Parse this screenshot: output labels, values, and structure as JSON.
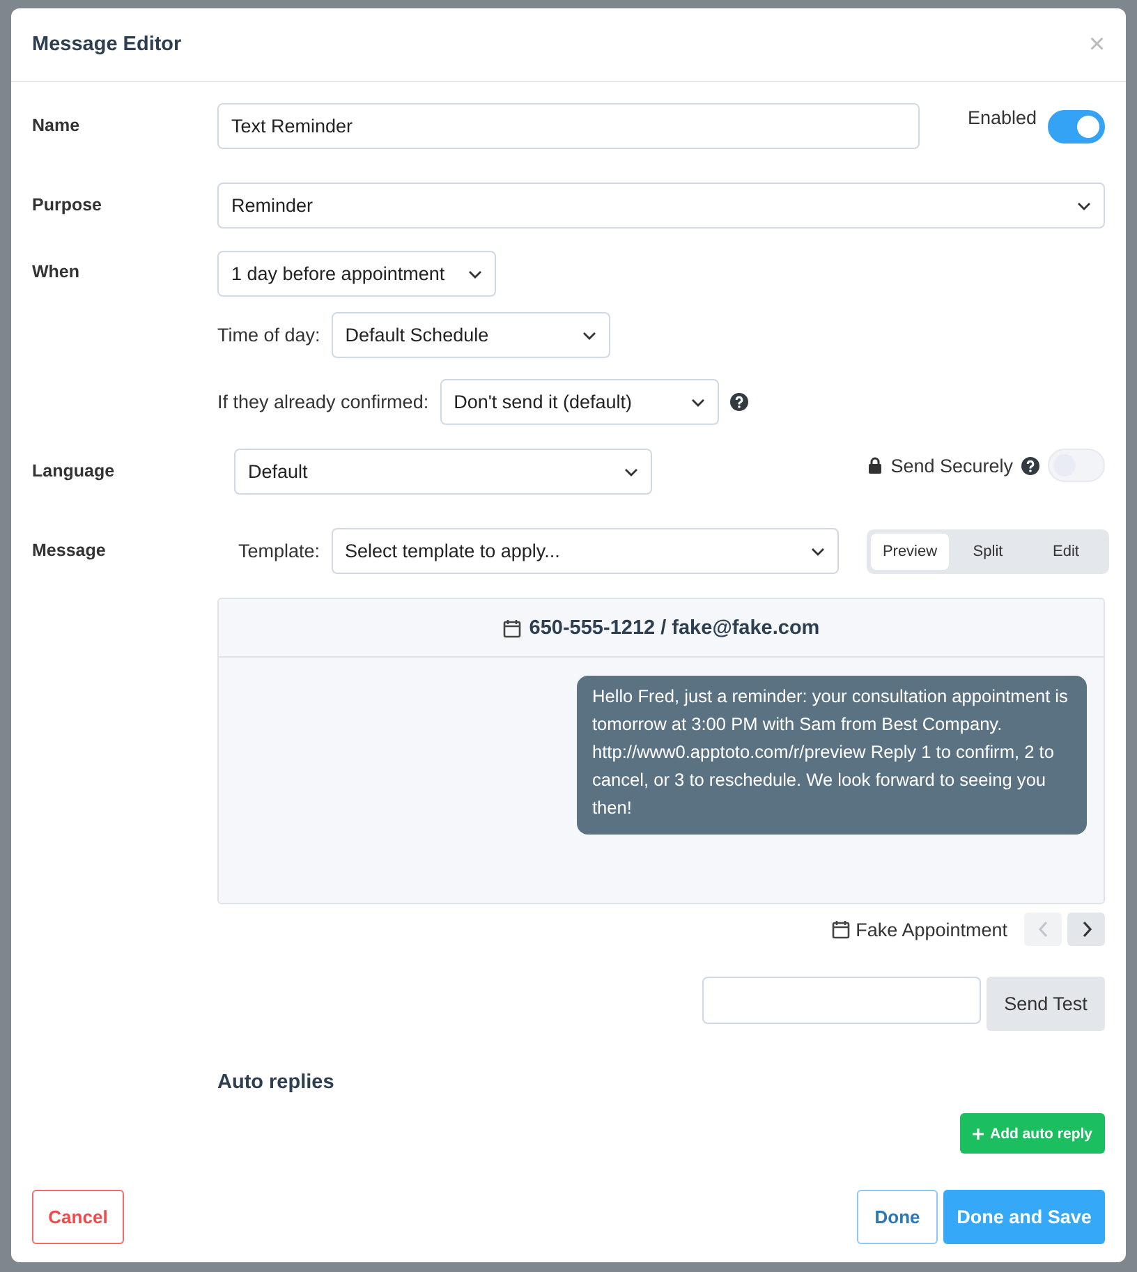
{
  "dialog": {
    "title": "Message Editor",
    "close": "×"
  },
  "name": {
    "label": "Name",
    "value": "Text Reminder"
  },
  "enabled": {
    "label": "Enabled",
    "on": true
  },
  "purpose": {
    "label": "Purpose",
    "value": "Reminder"
  },
  "when": {
    "label": "When",
    "value": "1 day before appointment",
    "time_of_day": {
      "label": "Time of day:",
      "value": "Default Schedule"
    },
    "if_confirmed": {
      "label": "If they already confirmed:",
      "value": "Don't send it (default)"
    }
  },
  "language": {
    "label": "Language",
    "value": "Default"
  },
  "send_securely": {
    "label": "Send Securely",
    "on": false
  },
  "message": {
    "label": "Message",
    "template": {
      "label": "Template:",
      "value": "Select template to apply..."
    },
    "view_modes": [
      {
        "label": "Preview",
        "selected": true
      },
      {
        "label": "Split",
        "selected": false
      },
      {
        "label": "Edit",
        "selected": false
      }
    ]
  },
  "preview": {
    "recipient": "650-555-1212 / fake@fake.com",
    "bubble": "Hello Fred, just a reminder: your consultation appointment is tomorrow at 3:00 PM with Sam from Best Company. http://www0.apptoto.com/r/preview Reply 1 to confirm, 2 to cancel, or 3 to reschedule. We look forward to seeing you then!",
    "appointment": "Fake Appointment",
    "prev": {
      "disabled": true
    },
    "next": {
      "disabled": false
    }
  },
  "send_test": {
    "button": "Send Test"
  },
  "auto_replies": {
    "heading": "Auto replies",
    "add_button": "Add auto reply"
  },
  "footer": {
    "cancel": "Cancel",
    "done": "Done",
    "done_save": "Done and Save"
  }
}
